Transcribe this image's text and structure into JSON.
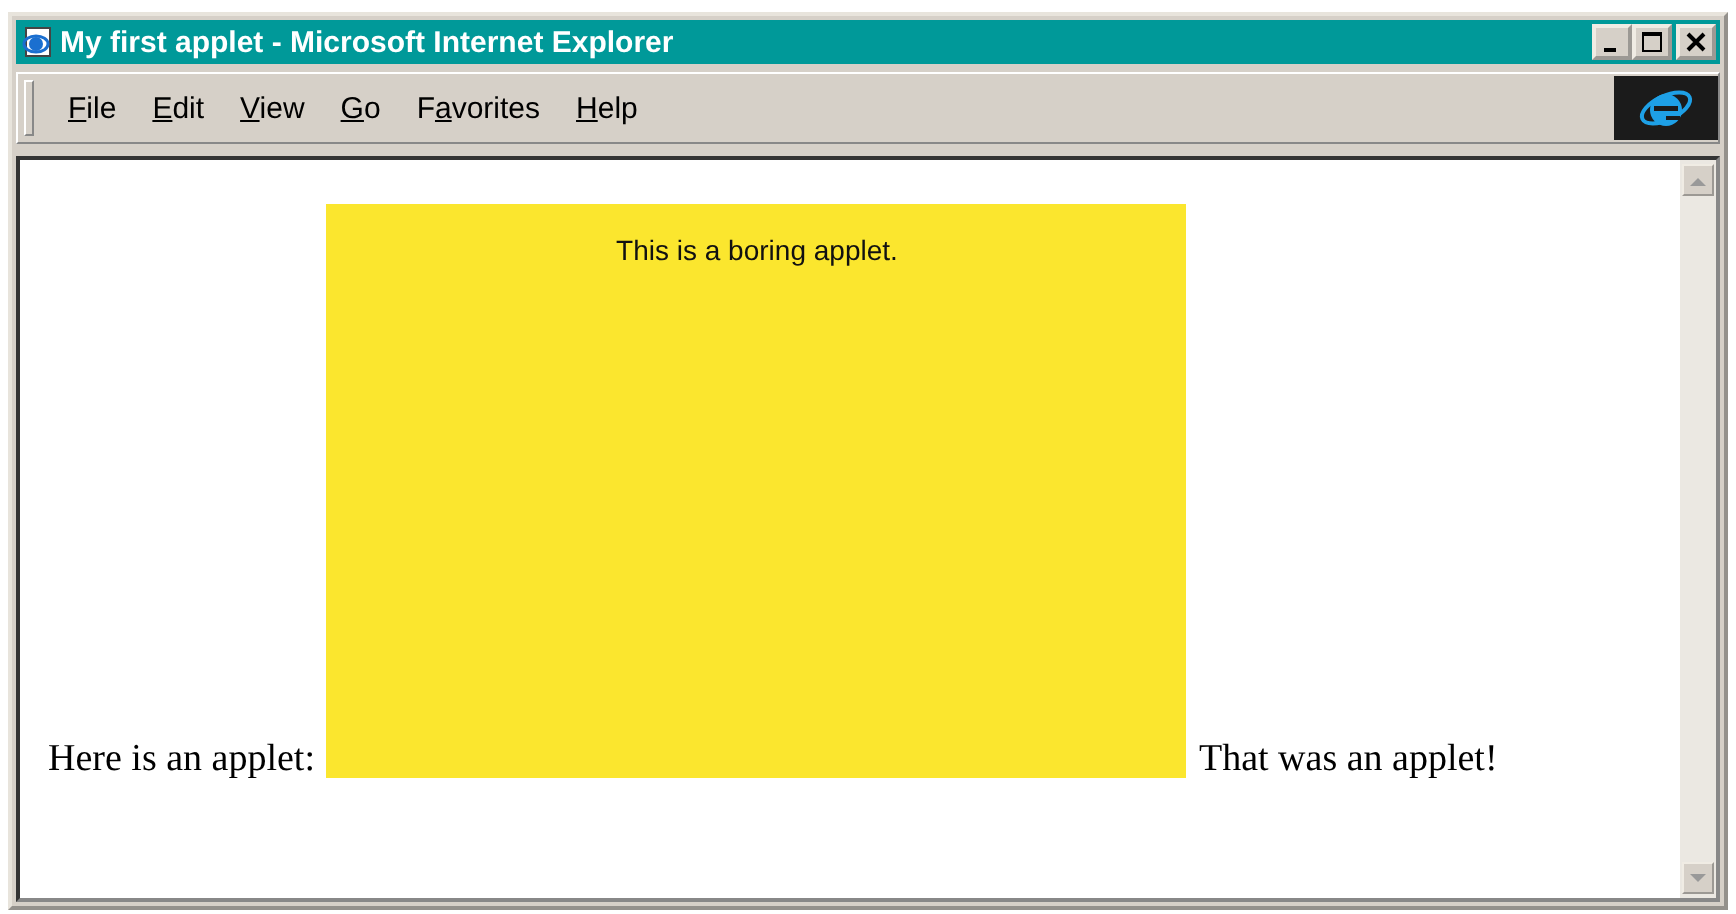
{
  "window": {
    "title": "My first applet - Microsoft Internet Explorer"
  },
  "menu": [
    {
      "key": "F",
      "rest": "ile"
    },
    {
      "key": "E",
      "rest": "dit"
    },
    {
      "key": "V",
      "rest": "iew"
    },
    {
      "key": "G",
      "rest": "o"
    },
    {
      "pre": "F",
      "key": "a",
      "rest": "vorites"
    },
    {
      "key": "H",
      "rest": "elp"
    }
  ],
  "page": {
    "text_before": "Here is an applet:",
    "applet_text": "This is a boring applet.",
    "text_after": "That was an applet!"
  }
}
